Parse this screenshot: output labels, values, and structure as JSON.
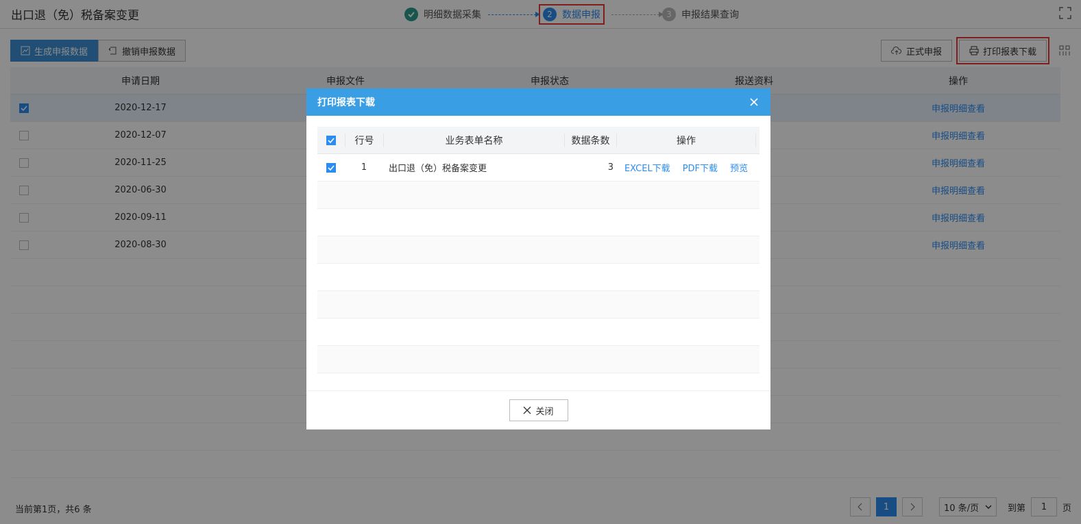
{
  "header": {
    "title": "出口退（免）税备案变更",
    "steps": [
      {
        "label": "明细数据采集",
        "num": "✓"
      },
      {
        "label": "数据申报",
        "num": "2"
      },
      {
        "label": "申报结果查询",
        "num": "3"
      }
    ]
  },
  "toolbar": {
    "generate_label": "生成申报数据",
    "revoke_label": "撤销申报数据",
    "formal_label": "正式申报",
    "print_label": "打印报表下载"
  },
  "table": {
    "headers": [
      "申请日期",
      "申报文件",
      "申报状态",
      "报送资料",
      "操作"
    ],
    "rows": [
      {
        "date": "2020-12-17",
        "op": "申报明细查看",
        "checked": true
      },
      {
        "date": "2020-12-07",
        "op": "申报明细查看",
        "checked": false
      },
      {
        "date": "2020-11-25",
        "op": "申报明细查看",
        "checked": false
      },
      {
        "date": "2020-06-30",
        "op": "申报明细查看",
        "checked": false
      },
      {
        "date": "2020-09-11",
        "op": "申报明细查看",
        "checked": false
      },
      {
        "date": "2020-08-30",
        "op": "申报明细查看",
        "checked": false
      }
    ]
  },
  "footer": {
    "info": "当前第1页，共6 条",
    "page": "1",
    "page_size": "10 条/页",
    "goto_label": "到第",
    "goto_value": "1",
    "page_suffix": "页"
  },
  "modal": {
    "title": "打印报表下载",
    "headers": {
      "no": "行号",
      "name": "业务表单名称",
      "count": "数据条数",
      "op": "操作"
    },
    "rows": [
      {
        "no": "1",
        "name": "出口退（免）税备案变更",
        "count": "3",
        "excel": "EXCEL下载",
        "pdf": "PDF下载",
        "preview": "预览"
      }
    ],
    "close_label": "关闭"
  },
  "colors": {
    "accent": "#2d8cf0",
    "modal_header": "#3a9ee4",
    "highlight": "#e53935"
  }
}
